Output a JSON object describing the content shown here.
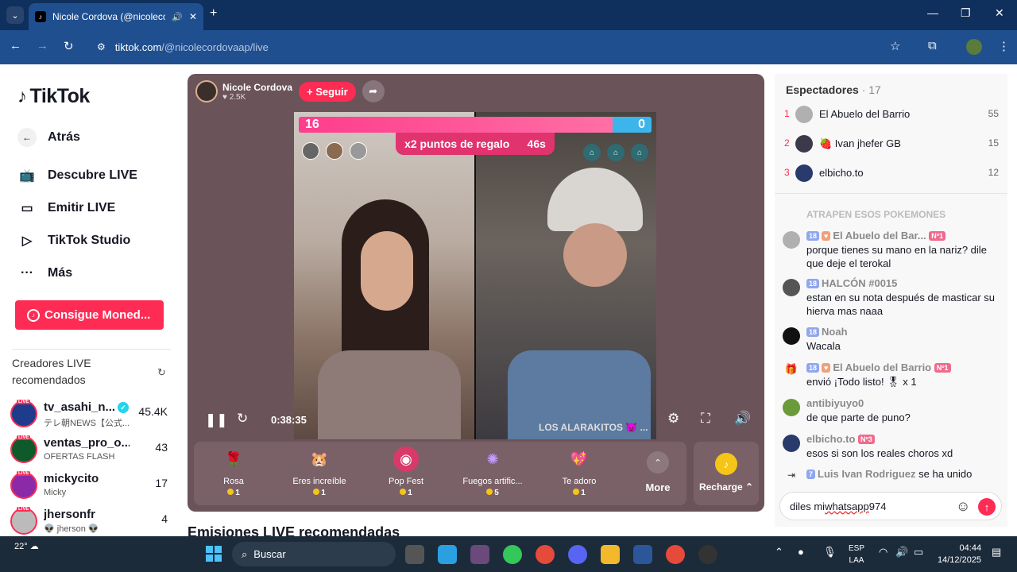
{
  "browser": {
    "tab_title": "Nicole Cordova (@nicoleco",
    "url_host": "tiktok.com",
    "url_path": "/@nicolecordovaap/live"
  },
  "sidebar": {
    "logo": "TikTok",
    "back": "Atrás",
    "nav": [
      "Descubre LIVE",
      "Emitir LIVE",
      "TikTok Studio",
      "Más"
    ],
    "coins_button": "Consigue Moned...",
    "recommended_title": "Creadores LIVE recomendados",
    "creators": [
      {
        "name": "tv_asahi_n...",
        "sub": "テレ朝NEWS【公式...",
        "count": "45.4K",
        "color": "#1f3b8c",
        "verified": "✓"
      },
      {
        "name": "ventas_pro_o...",
        "sub": "OFERTAS FLASH",
        "count": "43",
        "color": "#0e5a2a",
        "verified": ""
      },
      {
        "name": "mickycito",
        "sub": "Micky",
        "count": "17",
        "color": "#8a2aa8",
        "verified": ""
      },
      {
        "name": "jhersonfr",
        "sub": "👽 jherson 👽",
        "count": "4",
        "color": "#bbbbbb",
        "verified": ""
      }
    ]
  },
  "player": {
    "host_name": "Nicole Cordova",
    "host_likes": "♥ 2.5K",
    "follow": "+ Seguir",
    "score_left": "16",
    "score_right": "0",
    "boost_text": "x2 puntos de regalo",
    "boost_time": "46s",
    "elapsed": "0:38:35",
    "watermark": "LOS ALARAKITOS 👿 ...",
    "gifts": [
      {
        "name": "Rosa",
        "price": "1",
        "icon": "🌹",
        "bg": "transparent"
      },
      {
        "name": "Eres increíble",
        "price": "1",
        "icon": "🐹",
        "bg": "transparent"
      },
      {
        "name": "Pop Fest",
        "price": "1",
        "icon": "◉",
        "bg": "#d83a6a"
      },
      {
        "name": "Fuegos artific...",
        "price": "5",
        "icon": "✺",
        "bg": "transparent"
      },
      {
        "name": "Te adoro",
        "price": "1",
        "icon": "💖",
        "bg": "transparent"
      }
    ],
    "more": "More",
    "recharge": "Recharge ⌃"
  },
  "below_title": "Emisiones LIVE recomendadas",
  "chat": {
    "viewers_label": "Espectadores",
    "viewers_count": "· 17",
    "top_viewers": [
      {
        "rank": "1",
        "name": "El Abuelo del Barrio",
        "value": "55",
        "color": "#b0b0b0"
      },
      {
        "rank": "2",
        "name": "🍓 Ivan jhefer GB",
        "value": "15",
        "color": "#3a3a4a"
      },
      {
        "rank": "3",
        "name": "elbicho.to",
        "value": "12",
        "color": "#2a3a6a"
      }
    ],
    "faded_line": "ATRAPEN ESOS POKEMONES",
    "messages": [
      {
        "lvl": "18",
        "name": "El Abuelo del Bar...",
        "rank_badge": "Nº1",
        "text": "porque tienes su mano en la nariz? dile que deje el terokal",
        "color": "#b0b0b0"
      },
      {
        "lvl": "18",
        "name": "HALCÓN #0015",
        "rank_badge": "",
        "text": "estan en su nota después de masticar su hierva mas naaa",
        "color": "#555555"
      },
      {
        "lvl": "18",
        "name": "Noah",
        "rank_badge": "",
        "text": "Wacala",
        "color": "#111111"
      },
      {
        "lvl": "18",
        "name": "El Abuelo del Barrio",
        "rank_badge": "Nº1",
        "text": "envió ¡Todo listo! 🎖 x 1",
        "color": "#ffffff"
      },
      {
        "lvl": "",
        "name": "antibiyuyo0",
        "rank_badge": "",
        "text": "de que parte de puno?",
        "color": "#6a9a3a"
      },
      {
        "lvl": "",
        "name": "elbicho.to",
        "rank_badge": "Nº3",
        "text": "esos si son los reales choros xd",
        "color": "#2a3a6a"
      }
    ],
    "join": {
      "lvl": "7",
      "name": "Luis Ivan Rodriguez",
      "action": "se ha unido"
    },
    "input_prefix": "diles mi ",
    "input_wavy": "whatsapp",
    "input_suffix": " 974"
  },
  "taskbar": {
    "temp": "22°",
    "search": "Buscar",
    "lang1": "ESP",
    "lang2": "LAA",
    "time": "04:44",
    "date": "14/12/2025"
  }
}
